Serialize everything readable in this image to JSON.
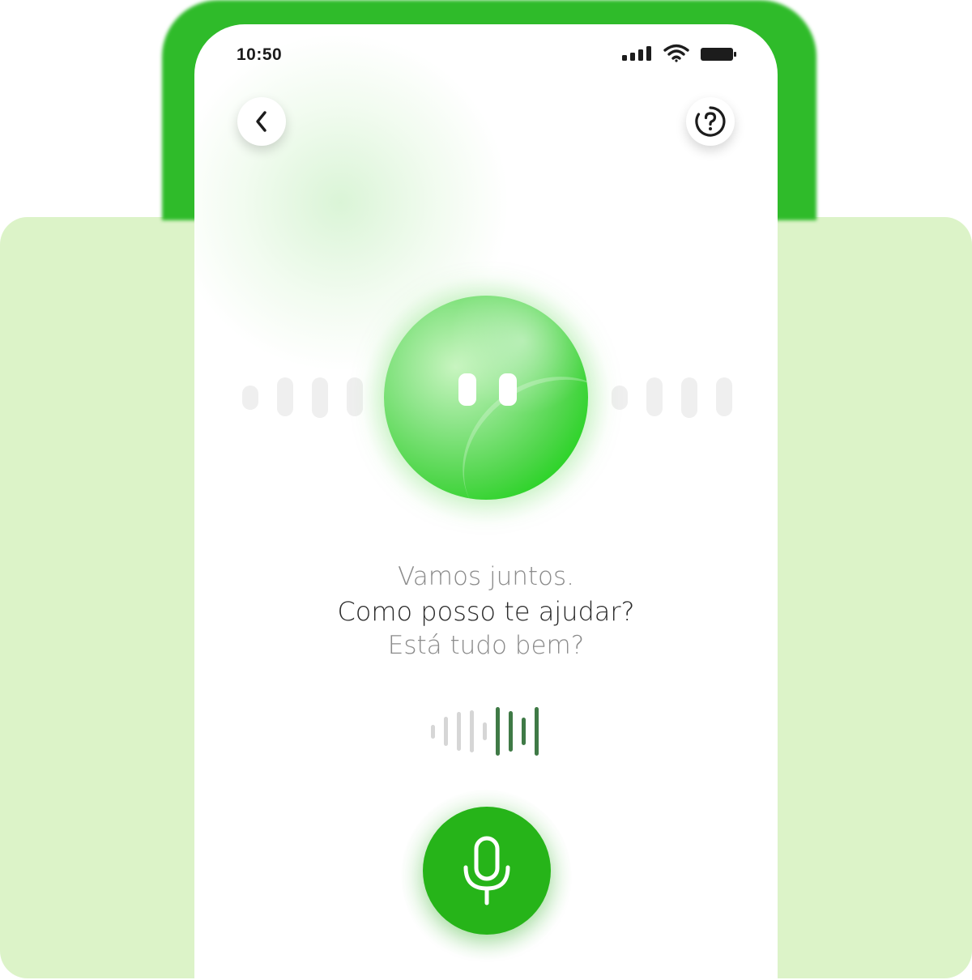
{
  "status_bar": {
    "time": "10:50"
  },
  "icons": {
    "back": "chevron-left-icon",
    "help": "question-circle-icon",
    "signal": "cellular-signal-icon",
    "wifi": "wifi-icon",
    "battery": "battery-icon",
    "mic": "microphone-icon"
  },
  "assistant": {
    "prompt_faded_top": "Vamos juntos.",
    "prompt_main": "Como posso te ajudar?",
    "prompt_faded_bottom": "Está tudo bem?"
  },
  "colors": {
    "brand_green": "#26b419",
    "background_card": "#dcf3c8",
    "waveform_active": "#3f7a46",
    "waveform_inactive": "#d6d6d6"
  }
}
